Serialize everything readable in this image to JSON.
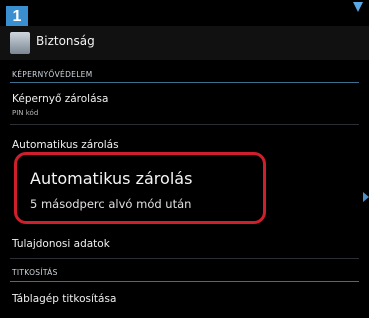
{
  "step_badge": "1",
  "actionbar": {
    "title": "Biztonság"
  },
  "sections": {
    "screen_protection": "KÉPERNYŐVÉDELEM",
    "encryption": "TITKOSÍTÁS"
  },
  "items": {
    "screen_lock": {
      "title": "Képernyő zárolása",
      "summary": "PIN kód"
    },
    "auto_lock": {
      "title": "Automatikus zárolás"
    },
    "owner_info": {
      "title": "Tulajdonosi adatok"
    },
    "tablet_encryption": {
      "title": "Táblagép titkosítása"
    }
  },
  "highlight": {
    "title": "Automatikus zárolás",
    "summary": "5 másodperc alvó mód után"
  },
  "colors": {
    "highlight_border": "#d01f2c",
    "badge": "#3a8fd0",
    "accent": "#4d8fc6"
  }
}
